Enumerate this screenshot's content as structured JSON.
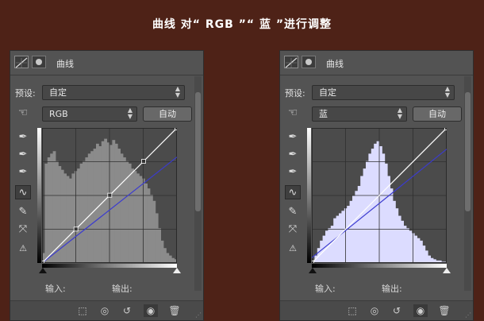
{
  "heading": "曲线 对“ RGB ”“ 蓝 ”进行调整",
  "panels": [
    {
      "tab_title": "曲线",
      "preset_label": "预设:",
      "preset_value": "自定",
      "channel_value": "RGB",
      "auto_label": "自动",
      "input_label": "输入:",
      "output_label": "输出:",
      "histogram_color": "#8b8b8b",
      "curve_color": "#ffffff",
      "reference_color": "#3b3bcf",
      "reference_line": [
        [
          0,
          0
        ],
        [
          255,
          200
        ]
      ],
      "histogram": [
        8,
        80,
        85,
        88,
        90,
        82,
        78,
        75,
        72,
        70,
        68,
        72,
        74,
        76,
        80,
        82,
        85,
        88,
        90,
        92,
        96,
        94,
        98,
        100,
        97,
        95,
        99,
        96,
        92,
        88,
        85,
        82,
        80,
        76,
        74,
        72,
        70,
        68,
        64,
        60,
        55,
        50,
        40,
        28,
        18,
        12,
        8,
        6,
        4,
        3
      ],
      "curve_points": [
        [
          0,
          0
        ],
        [
          64,
          64
        ],
        [
          128,
          128
        ],
        [
          192,
          192
        ],
        [
          255,
          255
        ]
      ]
    },
    {
      "tab_title": "曲线",
      "preset_label": "预设:",
      "preset_value": "自定",
      "channel_value": "蓝",
      "auto_label": "自动",
      "input_label": "输入:",
      "output_label": "输出:",
      "histogram_color": "#dcdcff",
      "curve_color": "#ffffff",
      "reference_color": "#3b3bcf",
      "reference_line": [
        [
          0,
          10
        ],
        [
          255,
          215
        ]
      ],
      "histogram": [
        2,
        6,
        12,
        18,
        22,
        26,
        28,
        30,
        36,
        38,
        40,
        42,
        44,
        46,
        50,
        54,
        58,
        62,
        70,
        76,
        82,
        88,
        92,
        96,
        98,
        94,
        88,
        80,
        70,
        60,
        50,
        44,
        38,
        34,
        30,
        28,
        26,
        24,
        22,
        20,
        18,
        14,
        10,
        6,
        4,
        3,
        2,
        2,
        1,
        1
      ],
      "curve_points": [
        [
          0,
          0
        ],
        [
          255,
          255
        ]
      ]
    }
  ],
  "icons": {
    "curves_tab": "curves-icon",
    "mask_tab": "mask-icon",
    "hand": "hand-icon",
    "eyedropper_black": "eyedropper-black-icon",
    "eyedropper_gray": "eyedropper-gray-icon",
    "eyedropper_white": "eyedropper-white-icon",
    "curve_tool": "curve-tool-icon",
    "pencil": "pencil-icon",
    "smooth": "smooth-icon",
    "clipping_warning": "clipping-warning-icon",
    "clip_to_layer": "clip-to-layer-icon",
    "view_previous": "view-previous-icon",
    "reset": "reset-icon",
    "visibility": "eye-icon",
    "delete": "trash-icon"
  }
}
